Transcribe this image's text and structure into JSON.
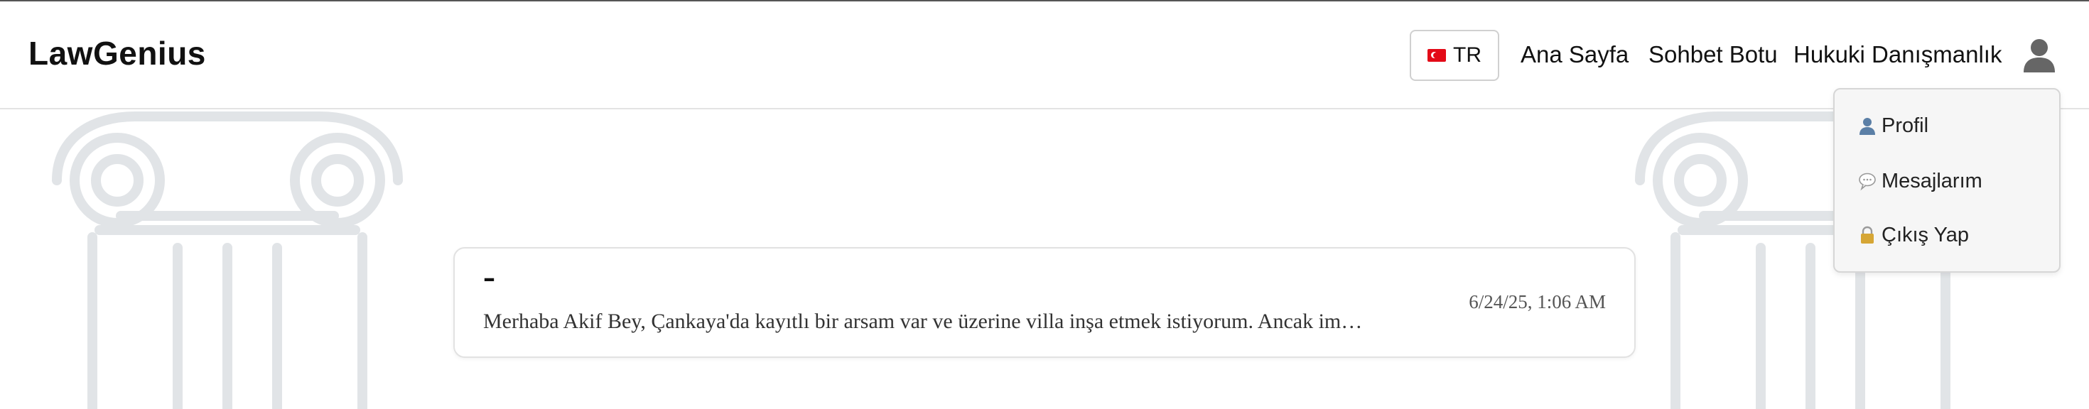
{
  "brand": {
    "name": "LawGenius"
  },
  "header": {
    "language_button": {
      "label": "TR",
      "flag": "turkey-flag-icon"
    },
    "nav": [
      {
        "label": "Ana Sayfa"
      },
      {
        "label": "Sohbet Botu"
      },
      {
        "label": "Hukuki Danışmanlık"
      }
    ],
    "user_icon": "user-icon"
  },
  "user_menu": {
    "items": [
      {
        "label": "Profil",
        "icon": "person-icon"
      },
      {
        "label": "Mesajlarım",
        "icon": "speech-bubble-icon"
      },
      {
        "label": "Çıkış Yap",
        "icon": "lock-icon"
      }
    ]
  },
  "conversation": {
    "title": "–",
    "preview": "Merhaba Akif Bey, Çankaya'da kayıtlı bir arsam var ve üzerine villa inşa etmek istiyorum. Ancak im…",
    "timestamp": "6/24/25, 1:06 AM"
  },
  "colors": {
    "pillar": "#e1e4e7",
    "accent_flag": "#e30a17",
    "card_border": "#e2e2e2"
  }
}
